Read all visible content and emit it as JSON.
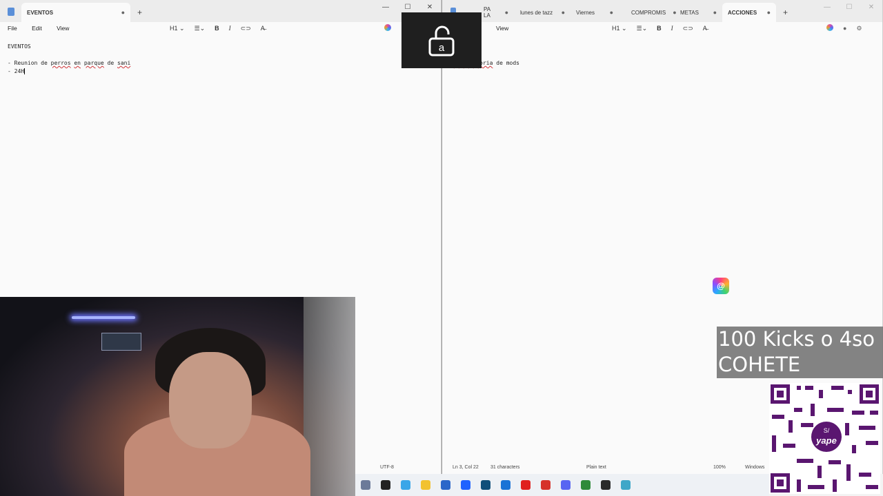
{
  "left_window": {
    "tabs": [
      {
        "label": "EVENTOS",
        "active": true
      }
    ],
    "menu": [
      "File",
      "Edit",
      "View"
    ],
    "heading_select": "H1",
    "editor_lines": [
      "EVENTOS",
      "",
      "- Reunion de perros en parque de sani",
      "- 24H"
    ],
    "status": {
      "encoding": "UTF-8"
    }
  },
  "right_window": {
    "tabs": [
      {
        "label": "PA LA",
        "active": false
      },
      {
        "label": "lunes de tazz",
        "active": false
      },
      {
        "label": "Viernes",
        "active": false
      },
      {
        "label": "COMPROMIS",
        "active": false
      },
      {
        "label": "METAS",
        "active": false
      },
      {
        "label": "ACCIONES",
        "active": true
      }
    ],
    "menu": [
      "View"
    ],
    "heading_select": "H1",
    "editor_lines": [
      "ACCIONES",
      "",
      "- Convocatoria de mods"
    ],
    "status": {
      "position": "Ln 3, Col 22",
      "chars": "31 characters",
      "format": "Plain text",
      "zoom": "100%",
      "eol": "Windows"
    }
  },
  "lock_popup": {
    "letter": "a"
  },
  "overlay": {
    "kicks_line1": "100 Kicks o 4so",
    "kicks_line2": "COHETE",
    "qr_brand": "yape",
    "qr_badge": "S/"
  },
  "taskbar": {
    "icons": [
      {
        "name": "snipping-tool-icon",
        "color": "#6c7a99"
      },
      {
        "name": "task-view-icon",
        "color": "#222222"
      },
      {
        "name": "copilot-icon",
        "color": "#3aa6e8"
      },
      {
        "name": "file-explorer-icon",
        "color": "#f2c230"
      },
      {
        "name": "calculator-icon",
        "color": "#2b66c9"
      },
      {
        "name": "dropbox-icon",
        "color": "#1f62ff"
      },
      {
        "name": "vscode-icon",
        "color": "#0f4f7a"
      },
      {
        "name": "outlook-icon",
        "color": "#1a73d6"
      },
      {
        "name": "opera-icon",
        "color": "#e0201d"
      },
      {
        "name": "wps-icon",
        "color": "#d6322a"
      },
      {
        "name": "discord-icon",
        "color": "#5865f2"
      },
      {
        "name": "chrome-canary-icon",
        "color": "#2f8a3a"
      },
      {
        "name": "obs-icon",
        "color": "#2a2a2a"
      },
      {
        "name": "notepad-icon",
        "color": "#3fa7c8"
      }
    ]
  },
  "colors": {
    "spellcheck": "#d13438",
    "accent": "#0067c0"
  }
}
